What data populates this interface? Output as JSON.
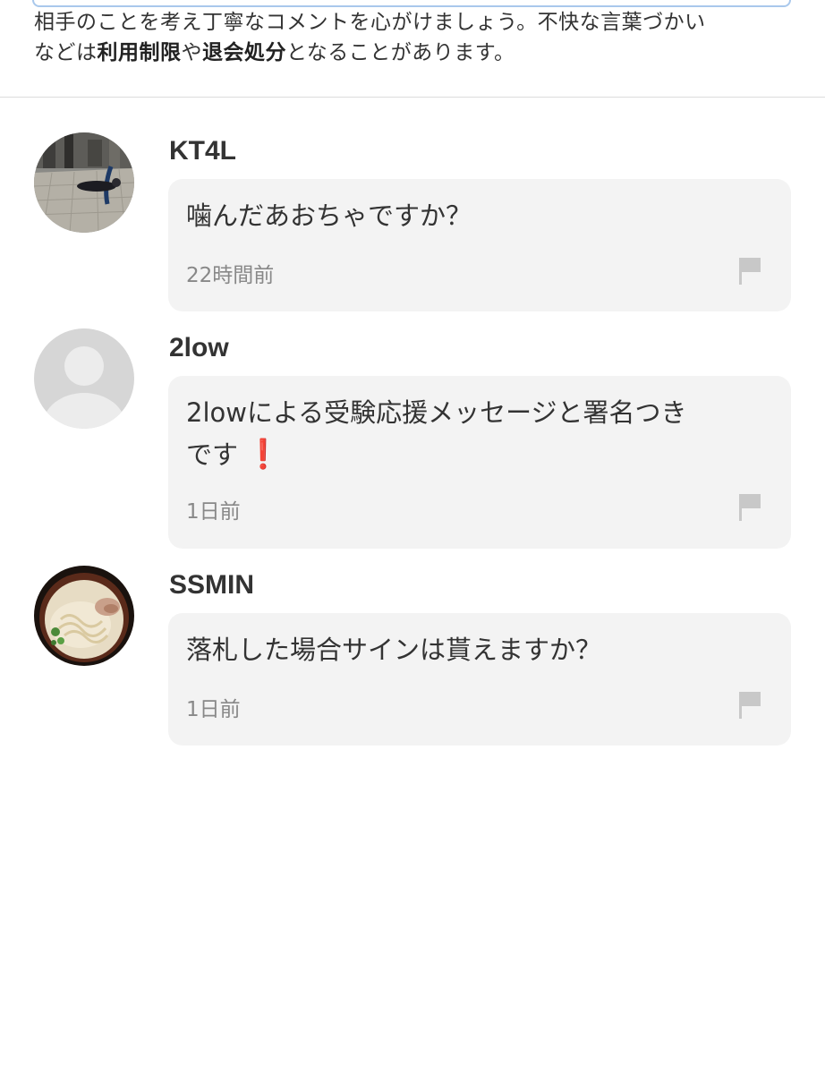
{
  "notice": {
    "line1": "相手のことを考え丁寧なコメントを心がけましょう。不快な言葉づかい",
    "line2_prefix": "などは",
    "bold1": "利用制限",
    "middle": "や",
    "bold2": "退会処分",
    "suffix": "となることがあります。"
  },
  "comments": [
    {
      "username": "KT4L",
      "text": "噛んだあおちゃですか？",
      "time": "22時間前"
    },
    {
      "username": "2low",
      "text_line1": "2lowによる受験応援メッセージと署名つき",
      "text_line2": "です",
      "emoji": "❗",
      "time": "1日前"
    },
    {
      "username": "SSMIN",
      "text": "落札した場合サインは貰えますか？",
      "time": "1日前"
    }
  ],
  "colors": {
    "bubble": "#f3f3f3",
    "divider": "#dcdcdc",
    "input_border": "#a9c8ec",
    "flag": "#c8c8c8",
    "heart": "#e2303c"
  },
  "icons": {
    "report": "flag-icon",
    "avatar_placeholder": "default-user-icon"
  }
}
